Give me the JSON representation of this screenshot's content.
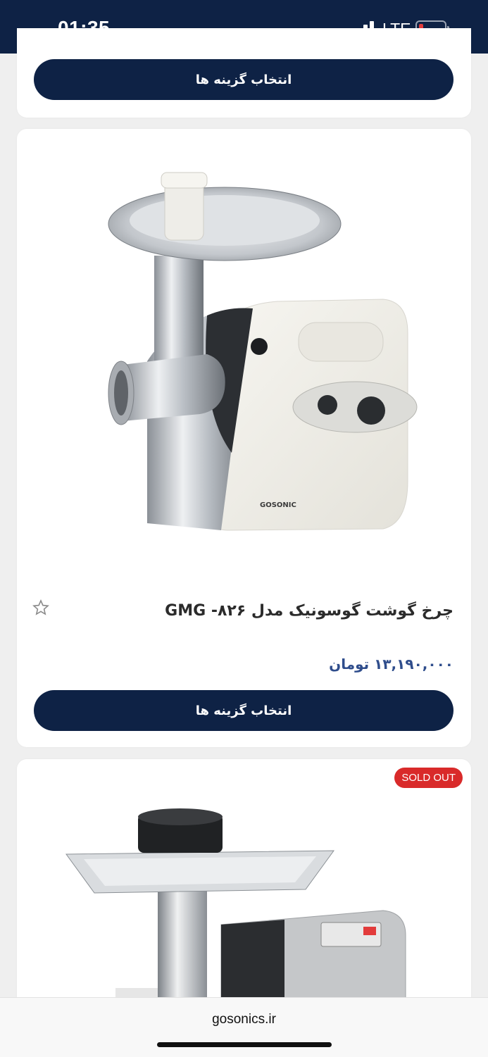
{
  "status_bar": {
    "time": "01:35",
    "network": "LTE"
  },
  "products": [
    {
      "button_label": "انتخاب گزینه ها"
    },
    {
      "title": "چرخ گوشت گوسونیک مدل GMG -۸۲۶",
      "price": "۱۳,۱۹۰,۰۰۰ تومان",
      "button_label": "انتخاب گزینه ها",
      "image_brand_text": "GOSONIC"
    },
    {
      "badge": "SOLD OUT"
    }
  ],
  "browser": {
    "url": "gosonics.ir"
  },
  "colors": {
    "primary": "#0e2245",
    "price": "#2f4d8c",
    "sold_out": "#d92a2a"
  }
}
